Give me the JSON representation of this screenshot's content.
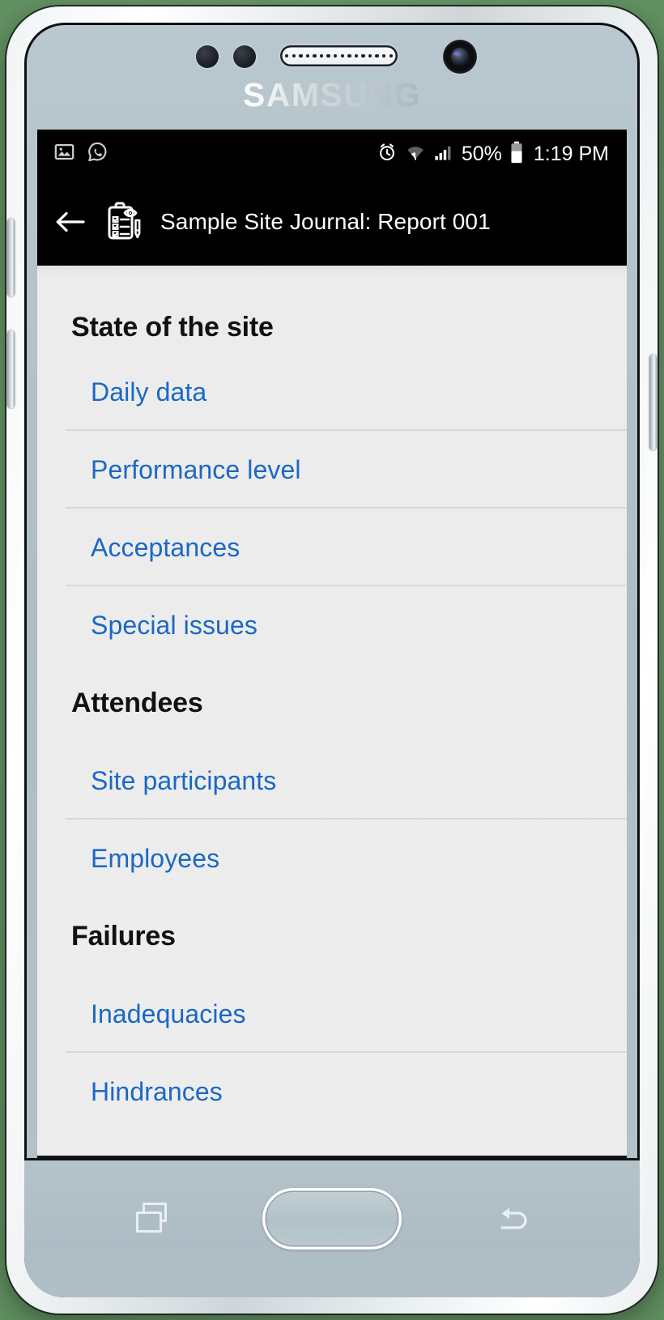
{
  "device": {
    "brand_logo": "SAMSUNG",
    "hardware": {
      "volume_up_label": "Volume up button",
      "volume_down_label": "Volume down button",
      "power_label": "Power button",
      "camera_label": "Front camera",
      "speaker_label": "Earpiece speaker",
      "sensor_label": "Proximity sensor"
    }
  },
  "status_bar": {
    "left_icons": [
      {
        "name": "gallery-icon",
        "glyph": "image"
      },
      {
        "name": "whatsapp-icon",
        "glyph": "whatsapp"
      }
    ],
    "right_icons": [
      {
        "name": "alarm-icon",
        "glyph": "alarm"
      },
      {
        "name": "wifi-icon",
        "glyph": "wifi"
      },
      {
        "name": "signal-icon",
        "glyph": "signal"
      }
    ],
    "battery_percent": "50%",
    "time": "1:19 PM",
    "background": "#000000",
    "foreground": "#ffffff"
  },
  "app_bar": {
    "back_label": "Back",
    "app_icon_name": "site-journal-clipboard-eye-icon",
    "title": "Sample Site Journal: Report 001",
    "background": "#000000",
    "title_color": "#ffffff"
  },
  "theme": {
    "screen_background": "#ececec",
    "link_color": "#1b68c4",
    "header_color": "#111111",
    "divider_color": "#d8d8d8"
  },
  "content": {
    "sections": [
      {
        "id": "state-of-the-site",
        "header": "State of the site",
        "items": [
          {
            "id": "daily-data",
            "label": "Daily data",
            "divider": true
          },
          {
            "id": "performance-level",
            "label": "Performance level",
            "divider": true
          },
          {
            "id": "acceptances",
            "label": "Acceptances",
            "divider": true
          },
          {
            "id": "special-issues",
            "label": "Special issues",
            "divider": false
          }
        ]
      },
      {
        "id": "attendees",
        "header": "Attendees",
        "items": [
          {
            "id": "site-participants",
            "label": "Site participants",
            "divider": true
          },
          {
            "id": "employees",
            "label": "Employees",
            "divider": false
          }
        ]
      },
      {
        "id": "failures",
        "header": "Failures",
        "items": [
          {
            "id": "inadequacies",
            "label": "Inadequacies",
            "divider": true
          },
          {
            "id": "hindrances",
            "label": "Hindrances",
            "divider": false
          }
        ]
      }
    ]
  },
  "nav_bar": {
    "recents_label": "Recent apps",
    "home_label": "Home",
    "back_label": "Back"
  }
}
